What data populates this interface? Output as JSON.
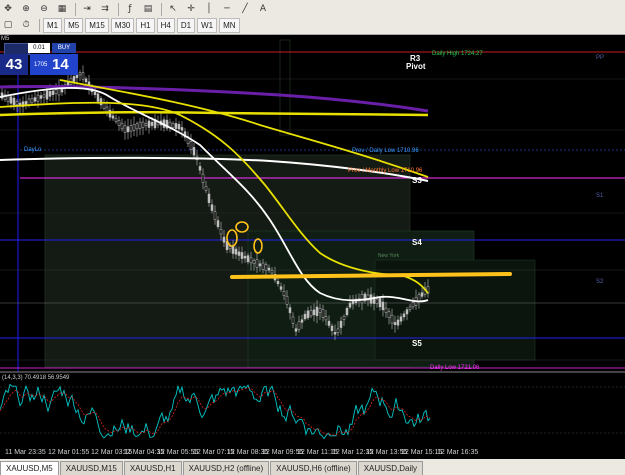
{
  "toolbar": {
    "timeframes": [
      "M1",
      "M5",
      "M15",
      "M30",
      "H1",
      "H4",
      "D1",
      "W1",
      "MN"
    ]
  },
  "trade_panel": {
    "symbol_tf": "M5",
    "lot": "0.01",
    "buy_label": "BUY",
    "sell_price_big": "43",
    "buy_price_small": "1705",
    "buy_price_big": "14"
  },
  "levels": {
    "daily_high": "Daily High 1724.27",
    "r3": "R3",
    "pivot": "Pivot",
    "prev_daily_low": "Prev / Daily Low 1710.96",
    "prev_monthly_low": "Prev / Monthly Low 1710.96",
    "s3": "S3",
    "s4": "S4",
    "s5": "S5",
    "daily_low": "Daily Low 1721.06",
    "daylo": "DayLo",
    "new_york": "New York",
    "pp": "PP",
    "s1": "S1",
    "s2": "S2"
  },
  "indicator": {
    "label": "(14,3,3) 70.4918 56.9549"
  },
  "time_axis": [
    "11 Mar 23:35",
    "12 Mar 01:55",
    "12 Mar 03:15",
    "12 Mar 04:35",
    "12 Mar 05:55",
    "12 Mar 07:15",
    "12 Mar 08:35",
    "12 Mar 09:55",
    "12 Mar 11:15",
    "12 Mar 12:35",
    "12 Mar 13:55",
    "12 Mar 15:15",
    "12 Mar 16:35"
  ],
  "tabs": [
    "XAUUSD,M5",
    "XAUUSD,M15",
    "XAUUSD,H1",
    "XAUUSD,H2 (offline)",
    "XAUUSD,H6 (offline)",
    "XAUUSD,Daily"
  ],
  "active_tab": 0,
  "colors": {
    "background": "#000000",
    "ma_yellow": "#e8e000",
    "ma_white": "#ffffff",
    "ma_purple": "#6a1fa8",
    "pivot_line": "#1a1aff",
    "daily_high": "#ff2a2a",
    "monthly_low": "#ff33ff",
    "annotation": "#ffc21a",
    "candle": "#bfbfbf"
  }
}
